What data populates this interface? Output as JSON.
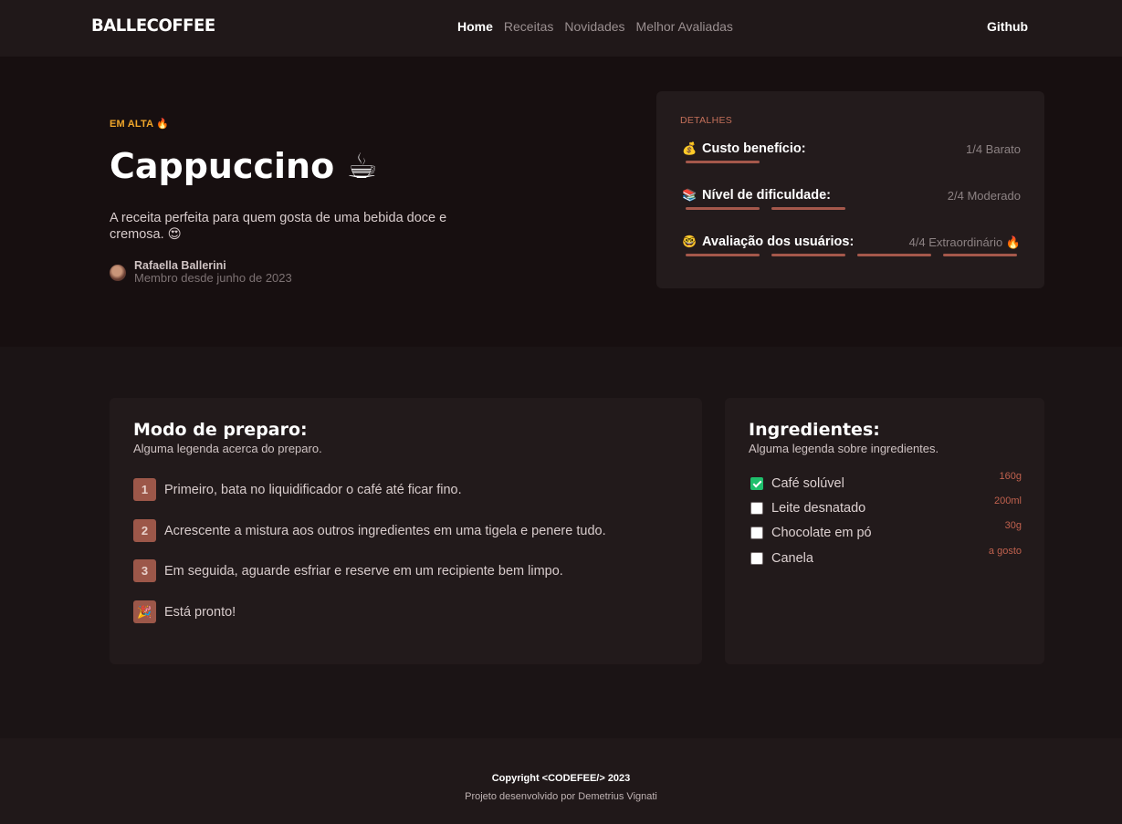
{
  "nav": {
    "logo": "BALLECOFFEE",
    "links": [
      "Home",
      "Receitas",
      "Novidades",
      "Melhor Avaliadas"
    ],
    "active": "Home",
    "github": "Github"
  },
  "hero": {
    "badge": "EM ALTA 🔥",
    "title": "Cappuccino ☕",
    "description": "A receita perfeita para quem gosta de uma bebida doce e cremosa. 😍",
    "author": {
      "name": "Rafaella Ballerini",
      "since": "Membro desde junho de 2023"
    }
  },
  "details": {
    "heading": "DETALHES",
    "rows": [
      {
        "icon": "💰",
        "label": "Custo benefício:",
        "value": "1/4 Barato",
        "level": 1
      },
      {
        "icon": "📚",
        "label": "Nível de dificuldade:",
        "value": "2/4 Moderado",
        "level": 2
      },
      {
        "icon": "🤓",
        "label": "Avaliação dos usuários:",
        "value": "4/4 Extraordinário 🔥",
        "level": 4
      }
    ]
  },
  "preparation": {
    "title": "Modo de preparo:",
    "subtitle": "Alguma legenda acerca do preparo.",
    "steps": [
      {
        "num": "1",
        "text": "Primeiro, bata no liquidificador o café até ficar fino."
      },
      {
        "num": "2",
        "text": "Acrescente a mistura aos outros ingredientes em uma tigela e penere tudo."
      },
      {
        "num": "3",
        "text": "Em seguida, aguarde esfriar e reserve em um recipiente bem limpo."
      },
      {
        "num": "🎉",
        "text": "Está pronto!"
      }
    ]
  },
  "ingredients": {
    "title": "Ingredientes:",
    "subtitle": "Alguma legenda sobre ingredientes.",
    "items": [
      {
        "name": "Café solúvel",
        "qty": "160g",
        "checked": true
      },
      {
        "name": "Leite desnatado",
        "qty": "200ml",
        "checked": false
      },
      {
        "name": "Chocolate em pó",
        "qty": "30g",
        "checked": false
      },
      {
        "name": "Canela",
        "qty": "a gosto",
        "checked": false
      }
    ]
  },
  "footer": {
    "copyright": "Copyright <CODEFEE/> 2023",
    "credit": "Projeto desenvolvido por Demetrius Vignati"
  },
  "colors": {
    "accent": "#a5584b",
    "badge": "#f0a62a",
    "check": "#1fbf6c"
  }
}
